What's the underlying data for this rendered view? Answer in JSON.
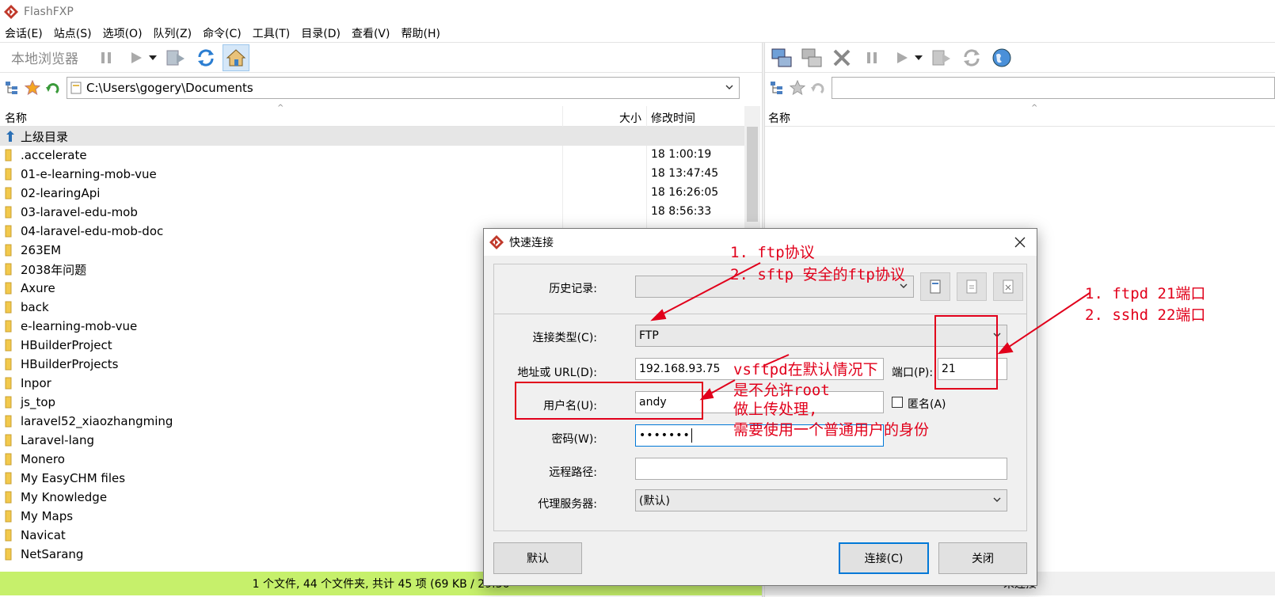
{
  "window": {
    "title": "FlashFXP"
  },
  "menu": [
    "会话(E)",
    "站点(S)",
    "选项(O)",
    "队列(Z)",
    "命令(C)",
    "工具(T)",
    "目录(D)",
    "查看(V)",
    "帮助(H)"
  ],
  "left_toolbar": {
    "label": "本地浏览器"
  },
  "left_address": {
    "path": "C:\\Users\\gogery\\Documents"
  },
  "right_address": {
    "path": ""
  },
  "left_columns": {
    "name": "名称",
    "size": "大小",
    "modified": "修改时间"
  },
  "right_columns": {
    "name": "名称"
  },
  "files": [
    {
      "name": "上级目录",
      "date": "",
      "type": "up"
    },
    {
      "name": ".accelerate",
      "date": "18 1:00:19",
      "type": "folder"
    },
    {
      "name": "01-e-learning-mob-vue",
      "date": "18 13:47:45",
      "type": "folder"
    },
    {
      "name": "02-learingApi",
      "date": "18 16:26:05",
      "type": "folder"
    },
    {
      "name": "03-laravel-edu-mob",
      "date": "18 8:56:33",
      "type": "folder"
    },
    {
      "name": "04-laravel-edu-mob-doc",
      "date": "",
      "type": "folder"
    },
    {
      "name": "263EM",
      "date": "",
      "type": "folder"
    },
    {
      "name": "2038年问题",
      "date": "",
      "type": "folder"
    },
    {
      "name": "Axure",
      "date": "",
      "type": "folder"
    },
    {
      "name": "back",
      "date": "",
      "type": "folder"
    },
    {
      "name": "e-learning-mob-vue",
      "date": "",
      "type": "folder"
    },
    {
      "name": "HBuilderProject",
      "date": "",
      "type": "folder"
    },
    {
      "name": "HBuilderProjects",
      "date": "",
      "type": "folder"
    },
    {
      "name": "Inpor",
      "date": "",
      "type": "folder"
    },
    {
      "name": "js_top",
      "date": "",
      "type": "folder"
    },
    {
      "name": "laravel52_xiaozhangming",
      "date": "",
      "type": "folder"
    },
    {
      "name": "Laravel-lang",
      "date": "",
      "type": "folder"
    },
    {
      "name": "Monero",
      "date": "",
      "type": "folder"
    },
    {
      "name": "My EasyCHM files",
      "date": "",
      "type": "folder"
    },
    {
      "name": "My Knowledge",
      "date": "",
      "type": "folder"
    },
    {
      "name": "My Maps",
      "date": "",
      "type": "folder"
    },
    {
      "name": "Navicat",
      "date": "",
      "type": "folder"
    },
    {
      "name": "NetSarang",
      "date": "",
      "type": "folder"
    }
  ],
  "status": {
    "left": "1 个文件, 44 个文件夹, 共计 45 项 (69 KB / 29.36",
    "right": "未连接"
  },
  "dialog": {
    "title": "快速连接",
    "history_label": "历史记录:",
    "history_value": "",
    "type_label": "连接类型(C):",
    "type_value": "FTP",
    "address_label": "地址或 URL(D):",
    "address_value": "192.168.93.75",
    "port_label": "端口(P):",
    "port_value": "21",
    "user_label": "用户名(U):",
    "user_value": "andy",
    "anon_label": "匿名(A)",
    "password_label": "密码(W):",
    "password_value": "•••••••",
    "remote_path_label": "远程路径:",
    "remote_path_value": "",
    "proxy_label": "代理服务器:",
    "proxy_value": "(默认)",
    "default_btn": "默认",
    "connect_btn": "连接(C)",
    "close_btn": "关闭"
  },
  "annotations": {
    "protocol_1": "1. ftp协议",
    "protocol_2": "2. sftp 安全的ftp协议",
    "port_1": "1. ftpd 21端口",
    "port_2": "2. sshd 22端口",
    "note_1": "vsftpd在默认情况下",
    "note_2": "是不允许root",
    "note_3": "做上传处理,",
    "note_4": "需要使用一个普通用户的身份"
  },
  "colors": {
    "annotation": "#e1001b",
    "status_ok": "#c6f06b",
    "accent": "#0078d7"
  }
}
